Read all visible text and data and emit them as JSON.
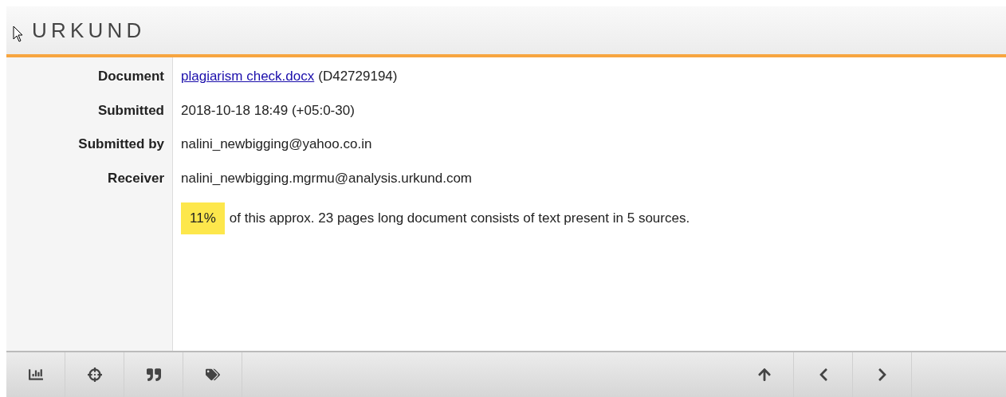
{
  "logo": {
    "text": "URKUND"
  },
  "fields": [
    {
      "label": "Document",
      "kind": "link",
      "link": "plagiarism check.docx",
      "value": "(D42729194)"
    },
    {
      "label": "Submitted",
      "kind": "text",
      "value": "2018-10-18 18:49 (+05:0-30)"
    },
    {
      "label": "Submitted by",
      "kind": "text",
      "value": "nalini_newbigging@yahoo.co.in"
    },
    {
      "label": "Receiver",
      "kind": "text",
      "value": "nalini_newbigging.mgrmu@analysis.urkund.com"
    }
  ],
  "summary": {
    "percentage": "11%",
    "text": "of this approx. 23 pages long document consists of text present in 5 sources."
  },
  "toolbar": {
    "left": [
      {
        "kind": "chart"
      },
      {
        "kind": "target"
      },
      {
        "kind": "quote"
      },
      {
        "kind": "tags"
      }
    ],
    "right": [
      {
        "kind": "up"
      },
      {
        "kind": "prev"
      },
      {
        "kind": "next"
      }
    ]
  }
}
